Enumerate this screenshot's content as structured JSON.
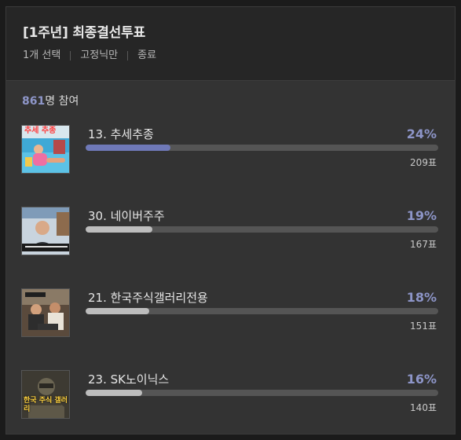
{
  "poll": {
    "title": "[1주년] 최종결선투표",
    "meta": [
      "1개 선택",
      "고정닉만",
      "종료"
    ],
    "participant_count": "861",
    "participant_suffix": "명 참여"
  },
  "options": [
    {
      "label": "13. 추세추종",
      "percent_text": "24%",
      "fraction": 0.24,
      "votes": "209표",
      "thumbnail": "pool-photo-thumbnail",
      "leading": true
    },
    {
      "label": "30. 네이버주주",
      "percent_text": "19%",
      "fraction": 0.19,
      "votes": "167표",
      "thumbnail": "person-video-thumbnail",
      "leading": false
    },
    {
      "label": "21. 한국주식갤러리전용",
      "percent_text": "18%",
      "fraction": 0.18,
      "votes": "151표",
      "thumbnail": "group-photo-thumbnail",
      "leading": false
    },
    {
      "label": "23. SK노이닉스",
      "percent_text": "16%",
      "fraction": 0.16,
      "votes": "140표",
      "thumbnail": "soldier-thumbnail",
      "leading": false
    }
  ],
  "thumbnail_captions": {
    "option_1_top": "추세 추종",
    "option_4_bottom": "한국 주식 갤러리"
  },
  "colors": {
    "accent": "#8d95c8",
    "leading_bar": "#6f79b8",
    "bar": "#bdbdbd",
    "track": "#555555",
    "panel": "#333333",
    "header": "#262626"
  }
}
